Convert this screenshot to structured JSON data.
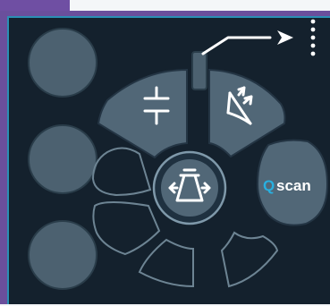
{
  "qscan": {
    "label_q": "Q",
    "label_rest": "scan"
  },
  "colors": {
    "frame": "#6a4f9c",
    "screen_bg": "#14212d",
    "segment": "#516777",
    "outline": "#6d8493",
    "accent": "#28b0e0"
  },
  "icons": {
    "left_buttons": [
      "blank-circle",
      "blank-circle",
      "blank-circle"
    ],
    "top_left_segment": "freeze-icon",
    "top_right_segment": "probe-sector-icon",
    "center_button": "transducer-icon",
    "top_right_corner": "arrow-with-dots-icon"
  }
}
